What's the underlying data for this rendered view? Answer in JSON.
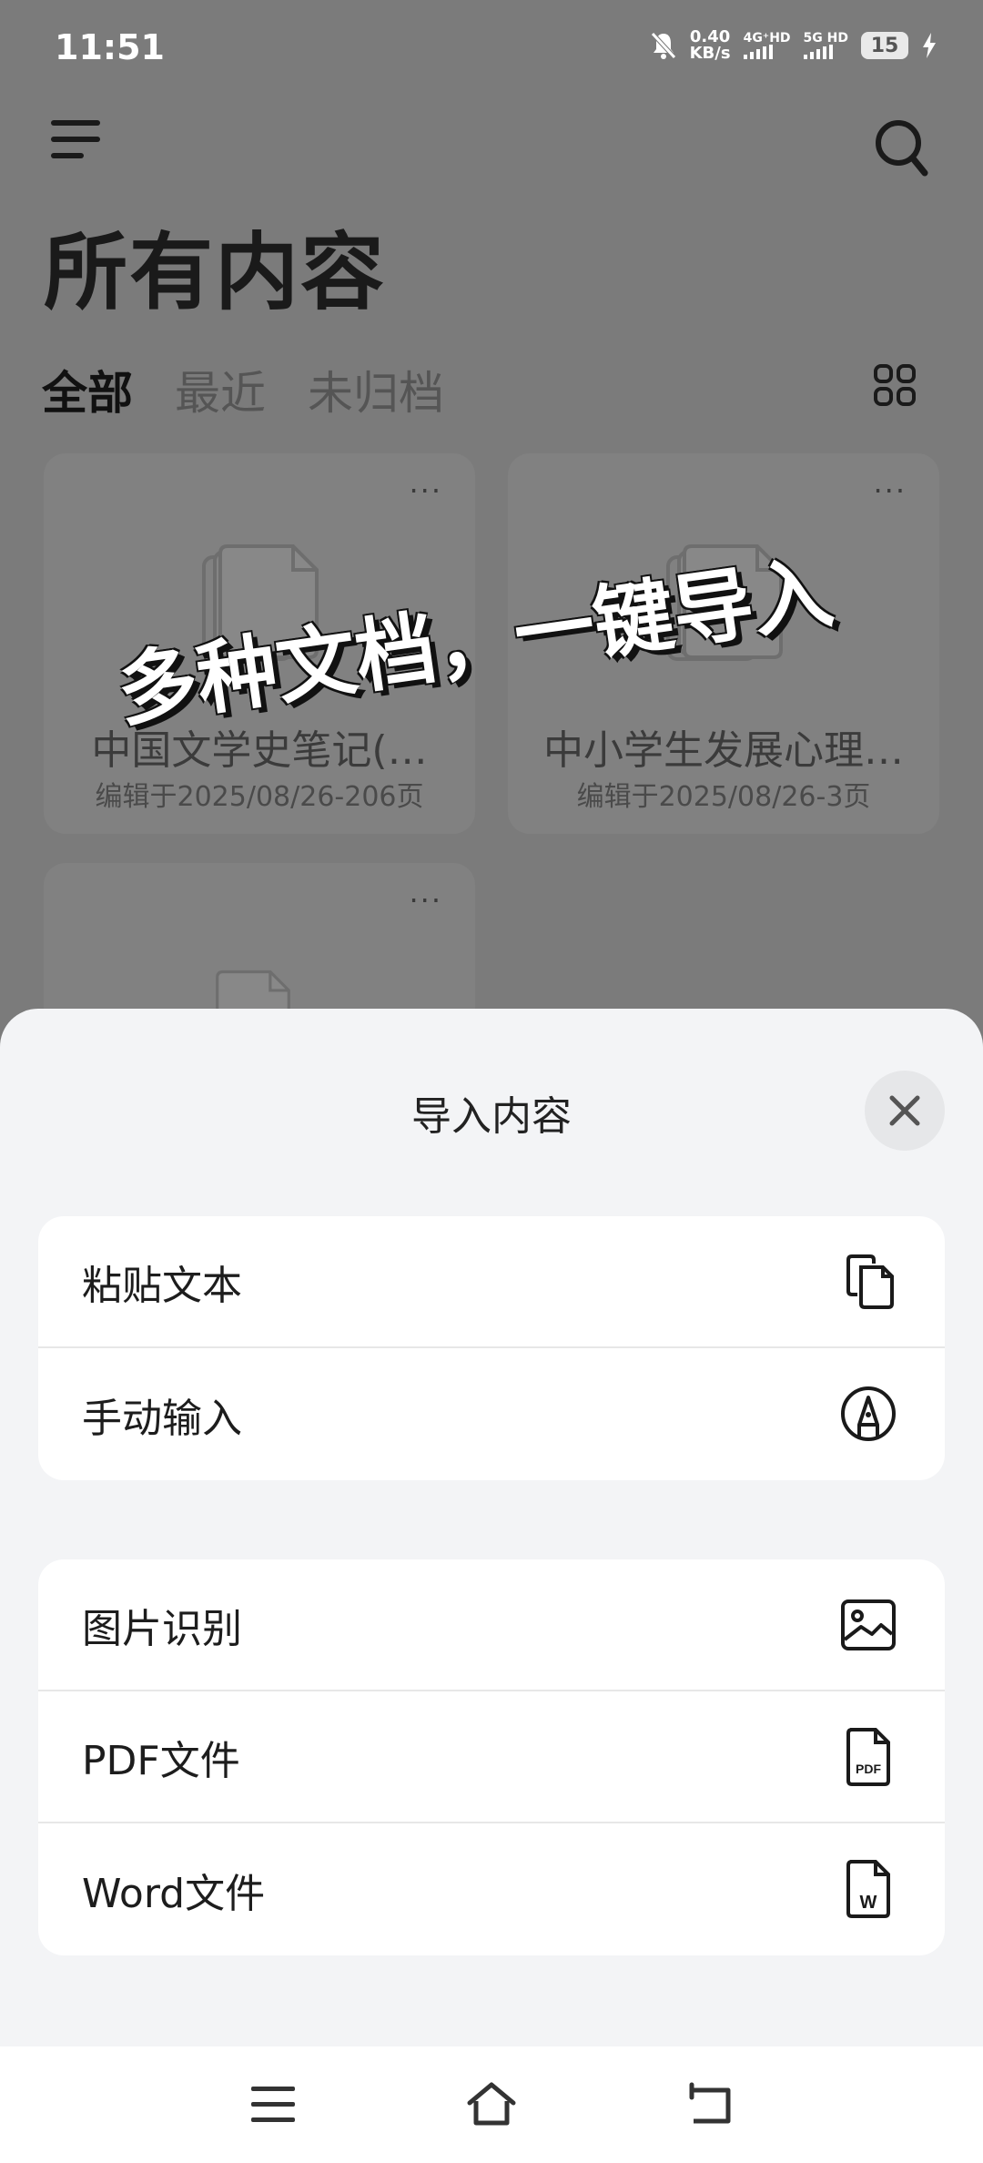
{
  "status_bar": {
    "time": "11:51",
    "speed_value": "0.40",
    "speed_unit": "KB/s",
    "net_1": "4G⁺HD",
    "net_2": "5G HD",
    "battery": "15"
  },
  "header": {
    "title": "所有内容"
  },
  "tabs": [
    {
      "label": "全部"
    },
    {
      "label": "最近"
    },
    {
      "label": "未归档"
    }
  ],
  "cards": [
    {
      "menu": "···",
      "title": "中国文学史笔记(…",
      "subtitle": "编辑于2025/08/26-206页"
    },
    {
      "menu": "···",
      "title": "中小学生发展心理…",
      "subtitle": "编辑于2025/08/26-3页"
    },
    {
      "menu": "···"
    }
  ],
  "caption": "多种文档，一键导入",
  "sheet": {
    "title": "导入内容",
    "group1": [
      {
        "label": "粘贴文本",
        "icon": "copy-icon"
      },
      {
        "label": "手动输入",
        "icon": "pen-icon"
      }
    ],
    "group2": [
      {
        "label": "图片识别",
        "icon": "image-icon"
      },
      {
        "label": "PDF文件",
        "icon": "pdf-icon"
      },
      {
        "label": "Word文件",
        "icon": "word-icon"
      }
    ],
    "pdf_badge": "PDF",
    "word_badge": "W"
  },
  "colors": {
    "backdrop": "#7b7b7b",
    "sheet_bg": "#f3f4f6",
    "row_bg": "#ffffff"
  }
}
